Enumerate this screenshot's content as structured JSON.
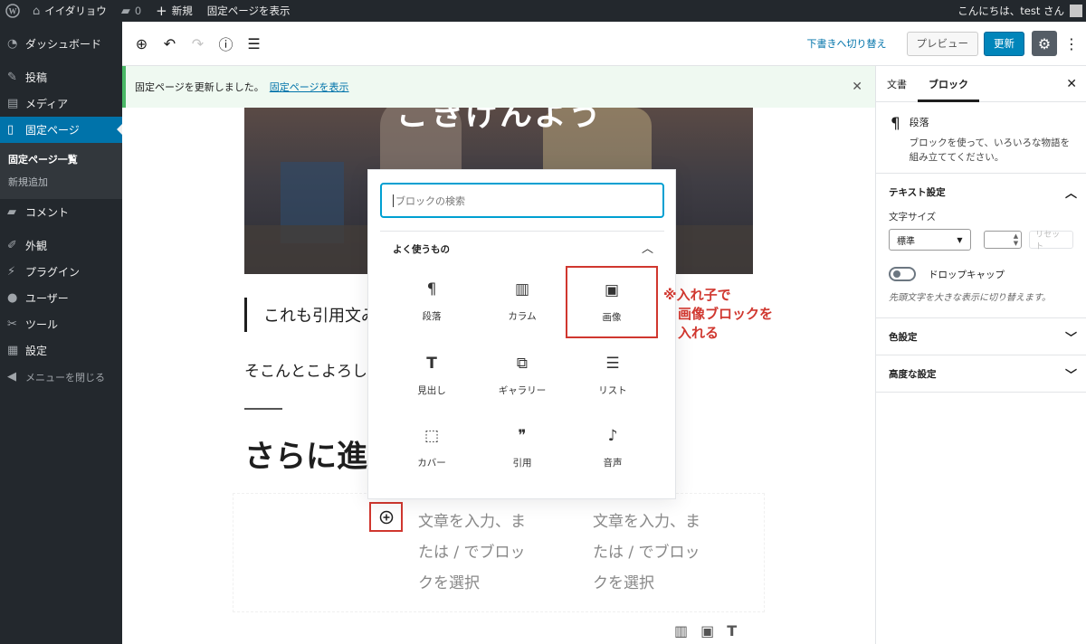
{
  "adminbar": {
    "site_name": "イイダリョウ",
    "comments_count": "0",
    "new_label": "新規",
    "view_page_label": "固定ページを表示",
    "greeting": "こんにちは、test さん"
  },
  "sidebar": {
    "items": [
      {
        "label": "ダッシュボード",
        "icon": "gauge-icon"
      },
      {
        "label": "投稿",
        "icon": "pin-icon"
      },
      {
        "label": "メディア",
        "icon": "media-icon"
      },
      {
        "label": "固定ページ",
        "icon": "page-icon"
      },
      {
        "label": "コメント",
        "icon": "comment-icon"
      },
      {
        "label": "外観",
        "icon": "brush-icon"
      },
      {
        "label": "プラグイン",
        "icon": "plugin-icon"
      },
      {
        "label": "ユーザー",
        "icon": "user-icon"
      },
      {
        "label": "ツール",
        "icon": "wrench-icon"
      },
      {
        "label": "設定",
        "icon": "settings-icon"
      },
      {
        "label": "メニューを閉じる",
        "icon": "collapse-icon"
      }
    ],
    "submenu": [
      "固定ページ一覧",
      "新規追加"
    ]
  },
  "header": {
    "draft_label": "下書きへ切り替え",
    "preview_label": "プレビュー",
    "update_label": "更新"
  },
  "notice": {
    "message": "固定ページを更新しました。",
    "link": "固定ページを表示"
  },
  "content": {
    "hero_text": "ごきげんよう",
    "quote": "これも引用文み",
    "paragraph": "そこんとこよろし",
    "heading": "さらに進",
    "column_placeholder_1": [
      "文章を入力、ま",
      "たは / でブロッ",
      "クを選択"
    ],
    "column_placeholder_2": [
      "文章を入力、ま",
      "たは / でブロッ",
      "クを選択"
    ]
  },
  "inserter": {
    "search_placeholder": "ブロックの検索",
    "panel_title": "よく使うもの",
    "blocks": [
      {
        "label": "段落",
        "icon": "¶"
      },
      {
        "label": "カラム",
        "icon": "▥"
      },
      {
        "label": "画像",
        "icon": "▣"
      },
      {
        "label": "見出し",
        "icon": "T"
      },
      {
        "label": "ギャラリー",
        "icon": "⧉"
      },
      {
        "label": "リスト",
        "icon": "☰"
      },
      {
        "label": "カバー",
        "icon": "⬚"
      },
      {
        "label": "引用",
        "icon": "❞"
      },
      {
        "label": "音声",
        "icon": "♪"
      }
    ]
  },
  "annotation": [
    "※入れ子で",
    "画像ブロックを",
    "入れる"
  ],
  "settings": {
    "tab_document": "文書",
    "tab_block": "ブロック",
    "block_title": "段落",
    "block_desc": "ブロックを使って、いろいろな物語を組み立ててください。",
    "text_settings": "テキスト設定",
    "font_size_label": "文字サイズ",
    "font_size_value": "標準",
    "reset_label": "リセット",
    "drop_cap_label": "ドロップキャップ",
    "drop_cap_help": "先頭文字を大きな表示に切り替えます。",
    "color_settings": "色設定",
    "advanced_settings": "高度な設定"
  },
  "colors": {
    "accent": "#0085ba",
    "annotation": "#d0372f",
    "admin_bg": "#23282d"
  }
}
